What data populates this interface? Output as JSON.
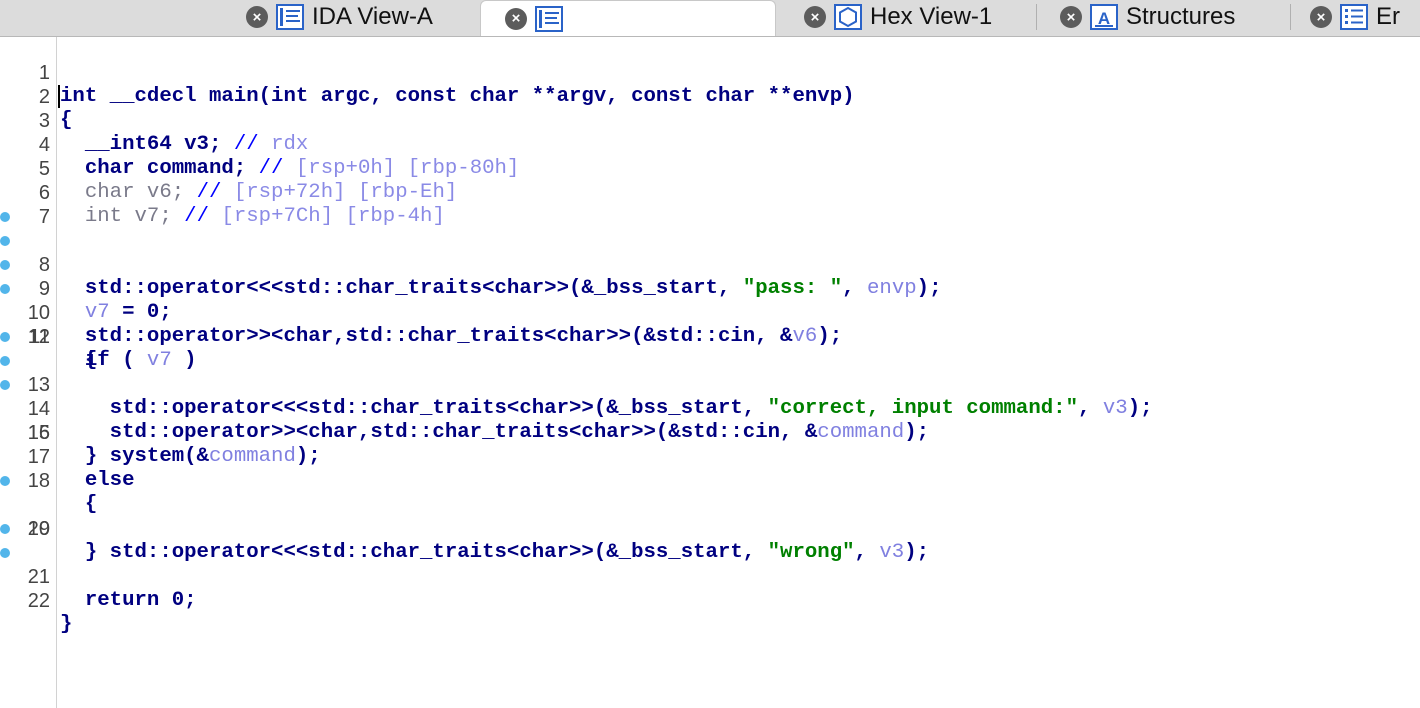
{
  "tabs": [
    {
      "label": "IDA View-A",
      "icon": "ida-view-icon",
      "active": false
    },
    {
      "label": "",
      "icon": "pseudocode-icon",
      "active": true
    },
    {
      "label": "Hex View-1",
      "icon": "hex-view-icon",
      "active": false
    },
    {
      "label": "Structures",
      "icon": "structures-icon",
      "active": false
    },
    {
      "label": "Er",
      "icon": "enums-icon",
      "active": false
    }
  ],
  "code_lines": [
    {
      "num": "1",
      "dot": false
    },
    {
      "num": "2",
      "dot": false
    },
    {
      "num": "3",
      "dot": false
    },
    {
      "num": "4",
      "dot": false
    },
    {
      "num": "5",
      "dot": false
    },
    {
      "num": "6",
      "dot": false
    },
    {
      "num": "7",
      "dot": false
    },
    {
      "num": "8",
      "dot": true
    },
    {
      "num": "9",
      "dot": true
    },
    {
      "num": "10",
      "dot": true
    },
    {
      "num": "11",
      "dot": true
    },
    {
      "num": "12",
      "dot": false
    },
    {
      "num": "13",
      "dot": true
    },
    {
      "num": "14",
      "dot": true
    },
    {
      "num": "15",
      "dot": true
    },
    {
      "num": "16",
      "dot": false
    },
    {
      "num": "17",
      "dot": false
    },
    {
      "num": "18",
      "dot": false
    },
    {
      "num": "19",
      "dot": true
    },
    {
      "num": "20",
      "dot": false
    },
    {
      "num": "21",
      "dot": true
    },
    {
      "num": "22",
      "dot": true
    }
  ],
  "code": {
    "l1": "int __cdecl main(int argc, const char **argv, const char **envp)",
    "l2": "{",
    "l3a": "  __int64 v3; ",
    "l3c": "// ",
    "l3v": "rdx",
    "l4a": "  char command; ",
    "l4c": "// ",
    "l4v": "[rsp+0h] [rbp-80h]",
    "l5a": "  char v6; ",
    "l5c": "// ",
    "l5v": "[rsp+72h] [rbp-Eh]",
    "l6a": "  int v7; ",
    "l6c": "// ",
    "l6v": "[rsp+7Ch] [rbp-4h]",
    "l7": "",
    "l8a": "  std::operator<<<std::char_traits<char>>(&_bss_start, ",
    "l8s": "\"pass: \"",
    "l8b": ", ",
    "l8v": "envp",
    "l8c": ");",
    "l9v": "  v7",
    "l9a": " = 0;",
    "l10a": "  std::operator>><char,std::char_traits<char>>(&std::cin, &",
    "l10v": "v6",
    "l10b": ");",
    "l11a": "  if ( ",
    "l11v": "v7",
    "l11b": " )",
    "l12": "  {",
    "l13a": "    std::operator<<<std::char_traits<char>>(&_bss_start, ",
    "l13s": "\"correct, input command:\"",
    "l13b": ", ",
    "l13v": "v3",
    "l13c": ");",
    "l14a": "    std::operator>><char,std::char_traits<char>>(&std::cin, &",
    "l14v": "command",
    "l14b": ");",
    "l15a": "    system(&",
    "l15v": "command",
    "l15b": ");",
    "l16": "  }",
    "l17": "  else",
    "l18": "  {",
    "l19a": "    std::operator<<<std::char_traits<char>>(&_bss_start, ",
    "l19s": "\"wrong\"",
    "l19b": ", ",
    "l19v": "v3",
    "l19c": ");",
    "l20": "  }",
    "l21": "  return 0;",
    "l22": "}"
  },
  "colors": {
    "code_keyword": "#000080",
    "string": "#008000",
    "variable": "#8080e0",
    "breakpoint_dot": "#52b5ea"
  }
}
